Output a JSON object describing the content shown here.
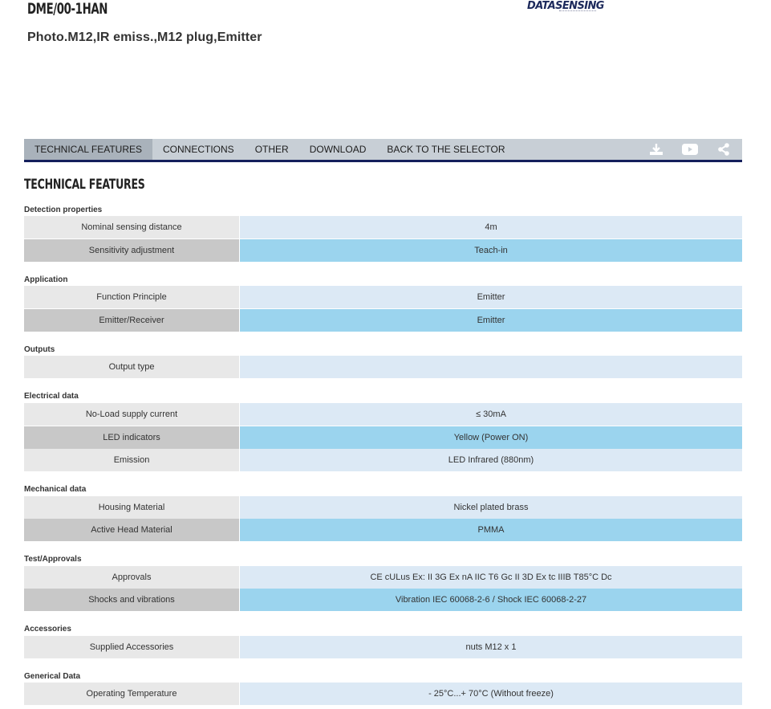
{
  "header": {
    "product_code": "DME/00-1HAN",
    "product_description": "Photo.M12,IR emiss.,M12 plug,Emitter",
    "logo_text": "DATASENSING"
  },
  "nav": {
    "tabs": [
      {
        "label": "TECHNICAL FEATURES",
        "active": true
      },
      {
        "label": "CONNECTIONS",
        "active": false
      },
      {
        "label": "OTHER",
        "active": false
      },
      {
        "label": "DOWNLOAD",
        "active": false
      },
      {
        "label": "BACK TO THE SELECTOR",
        "active": false
      }
    ],
    "icons": [
      "download-icon",
      "video-icon",
      "share-icon"
    ]
  },
  "section_title": "TECHNICAL FEATURES",
  "groups": [
    {
      "title": "Detection properties",
      "rows": [
        {
          "label": "Nominal sensing distance",
          "value": "4m"
        },
        {
          "label": "Sensitivity adjustment",
          "value": "Teach-in"
        }
      ]
    },
    {
      "title": "Application",
      "rows": [
        {
          "label": "Function Principle",
          "value": "Emitter"
        },
        {
          "label": "Emitter/Receiver",
          "value": "Emitter"
        }
      ]
    },
    {
      "title": "Outputs",
      "rows": [
        {
          "label": "Output type",
          "value": ""
        }
      ]
    },
    {
      "title": "Electrical data",
      "rows": [
        {
          "label": "No-Load supply current",
          "value": "≤ 30mA"
        },
        {
          "label": "LED indicators",
          "value": "Yellow (Power ON)"
        },
        {
          "label": "Emission",
          "value": "LED Infrared (880nm)"
        }
      ]
    },
    {
      "title": "Mechanical data",
      "rows": [
        {
          "label": "Housing Material",
          "value": "Nickel plated brass"
        },
        {
          "label": "Active Head Material",
          "value": "PMMA"
        }
      ]
    },
    {
      "title": "Test/Approvals",
      "rows": [
        {
          "label": "Approvals",
          "value": "CE cULus Ex: II 3G Ex nA IIC T6 Gc II 3D Ex tc IIIB T85°C Dc"
        },
        {
          "label": "Shocks and vibrations",
          "value": "Vibration IEC 60068-2-6 / Shock IEC 60068-2-27"
        }
      ]
    },
    {
      "title": "Accessories",
      "rows": [
        {
          "label": "Supplied Accessories",
          "value": "nuts M12 x 1"
        }
      ]
    },
    {
      "title": "Generical Data",
      "rows": [
        {
          "label": "Operating Temperature",
          "value": "- 25°C...+ 70°C (Without freeze)"
        }
      ]
    }
  ],
  "colors": {
    "nav_background": "#c8cfd6",
    "nav_active": "#a9b2bb",
    "nav_underline": "#141f5c",
    "row_label_light": "#e8e8e8",
    "row_label_dark": "#c8c8c8",
    "row_value_light": "#dce9f5",
    "row_value_dark": "#9bd4ee"
  }
}
